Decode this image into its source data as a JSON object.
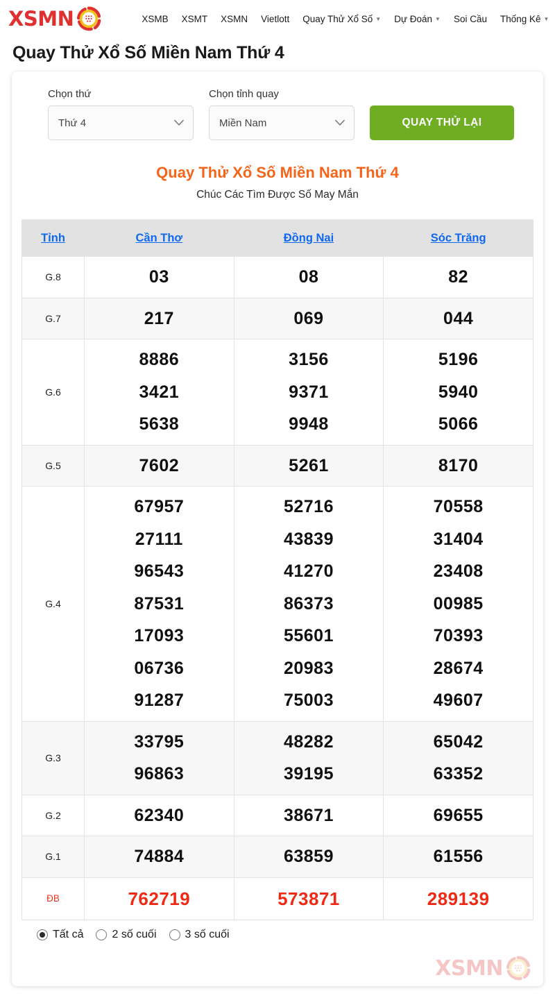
{
  "brand": {
    "name": "XSMN",
    "logo_icon": "lottery-ball-icon"
  },
  "nav": {
    "items": [
      {
        "label": "XSMB",
        "has_dropdown": false
      },
      {
        "label": "XSMT",
        "has_dropdown": false
      },
      {
        "label": "XSMN",
        "has_dropdown": false
      },
      {
        "label": "Vietlott",
        "has_dropdown": false
      },
      {
        "label": "Quay Thử Xổ Số",
        "has_dropdown": true
      },
      {
        "label": "Dự Đoán",
        "has_dropdown": true
      },
      {
        "label": "Soi Cầu",
        "has_dropdown": false
      },
      {
        "label": "Thống Kê",
        "has_dropdown": true
      }
    ]
  },
  "page": {
    "title": "Quay Thử Xổ Số Miền Nam Thứ 4",
    "result_title": "Quay Thử Xổ Số Miền Nam Thứ 4",
    "result_subtitle": "Chúc Các Tìm Được Số May Mắn"
  },
  "filters": {
    "day": {
      "label": "Chọn thứ",
      "value": "Thứ 4"
    },
    "province": {
      "label": "Chọn tỉnh quay",
      "value": "Miền Nam"
    },
    "submit_label": "QUAY THỬ LẠI"
  },
  "table": {
    "headers": [
      "Tỉnh",
      "Cần Thơ",
      "Đồng Nai",
      "Sóc Trăng"
    ],
    "rows": [
      {
        "prize": "G.8",
        "values": [
          [
            "03"
          ],
          [
            "08"
          ],
          [
            "82"
          ]
        ]
      },
      {
        "prize": "G.7",
        "values": [
          [
            "217"
          ],
          [
            "069"
          ],
          [
            "044"
          ]
        ]
      },
      {
        "prize": "G.6",
        "values": [
          [
            "8886",
            "3421",
            "5638"
          ],
          [
            "3156",
            "9371",
            "9948"
          ],
          [
            "5196",
            "5940",
            "5066"
          ]
        ]
      },
      {
        "prize": "G.5",
        "values": [
          [
            "7602"
          ],
          [
            "5261"
          ],
          [
            "8170"
          ]
        ]
      },
      {
        "prize": "G.4",
        "values": [
          [
            "67957",
            "27111",
            "96543",
            "87531",
            "17093",
            "06736",
            "91287"
          ],
          [
            "52716",
            "43839",
            "41270",
            "86373",
            "55601",
            "20983",
            "75003"
          ],
          [
            "70558",
            "31404",
            "23408",
            "00985",
            "70393",
            "28674",
            "49607"
          ]
        ]
      },
      {
        "prize": "G.3",
        "values": [
          [
            "33795",
            "96863"
          ],
          [
            "48282",
            "39195"
          ],
          [
            "65042",
            "63352"
          ]
        ]
      },
      {
        "prize": "G.2",
        "values": [
          [
            "62340"
          ],
          [
            "38671"
          ],
          [
            "69655"
          ]
        ]
      },
      {
        "prize": "G.1",
        "values": [
          [
            "74884"
          ],
          [
            "63859"
          ],
          [
            "61556"
          ]
        ]
      },
      {
        "prize": "ĐB",
        "values": [
          [
            "762719"
          ],
          [
            "573871"
          ],
          [
            "289139"
          ]
        ],
        "highlight": true
      }
    ]
  },
  "footer": {
    "radios": [
      {
        "label": "Tất cả",
        "checked": true
      },
      {
        "label": "2 số cuối",
        "checked": false
      },
      {
        "label": "3 số cuối",
        "checked": false
      }
    ]
  },
  "colors": {
    "brand_red": "#e03030",
    "accent_orange": "#f4651a",
    "link_blue": "#1168f0",
    "button_green": "#6fae23",
    "db_red": "#ee2a14"
  }
}
